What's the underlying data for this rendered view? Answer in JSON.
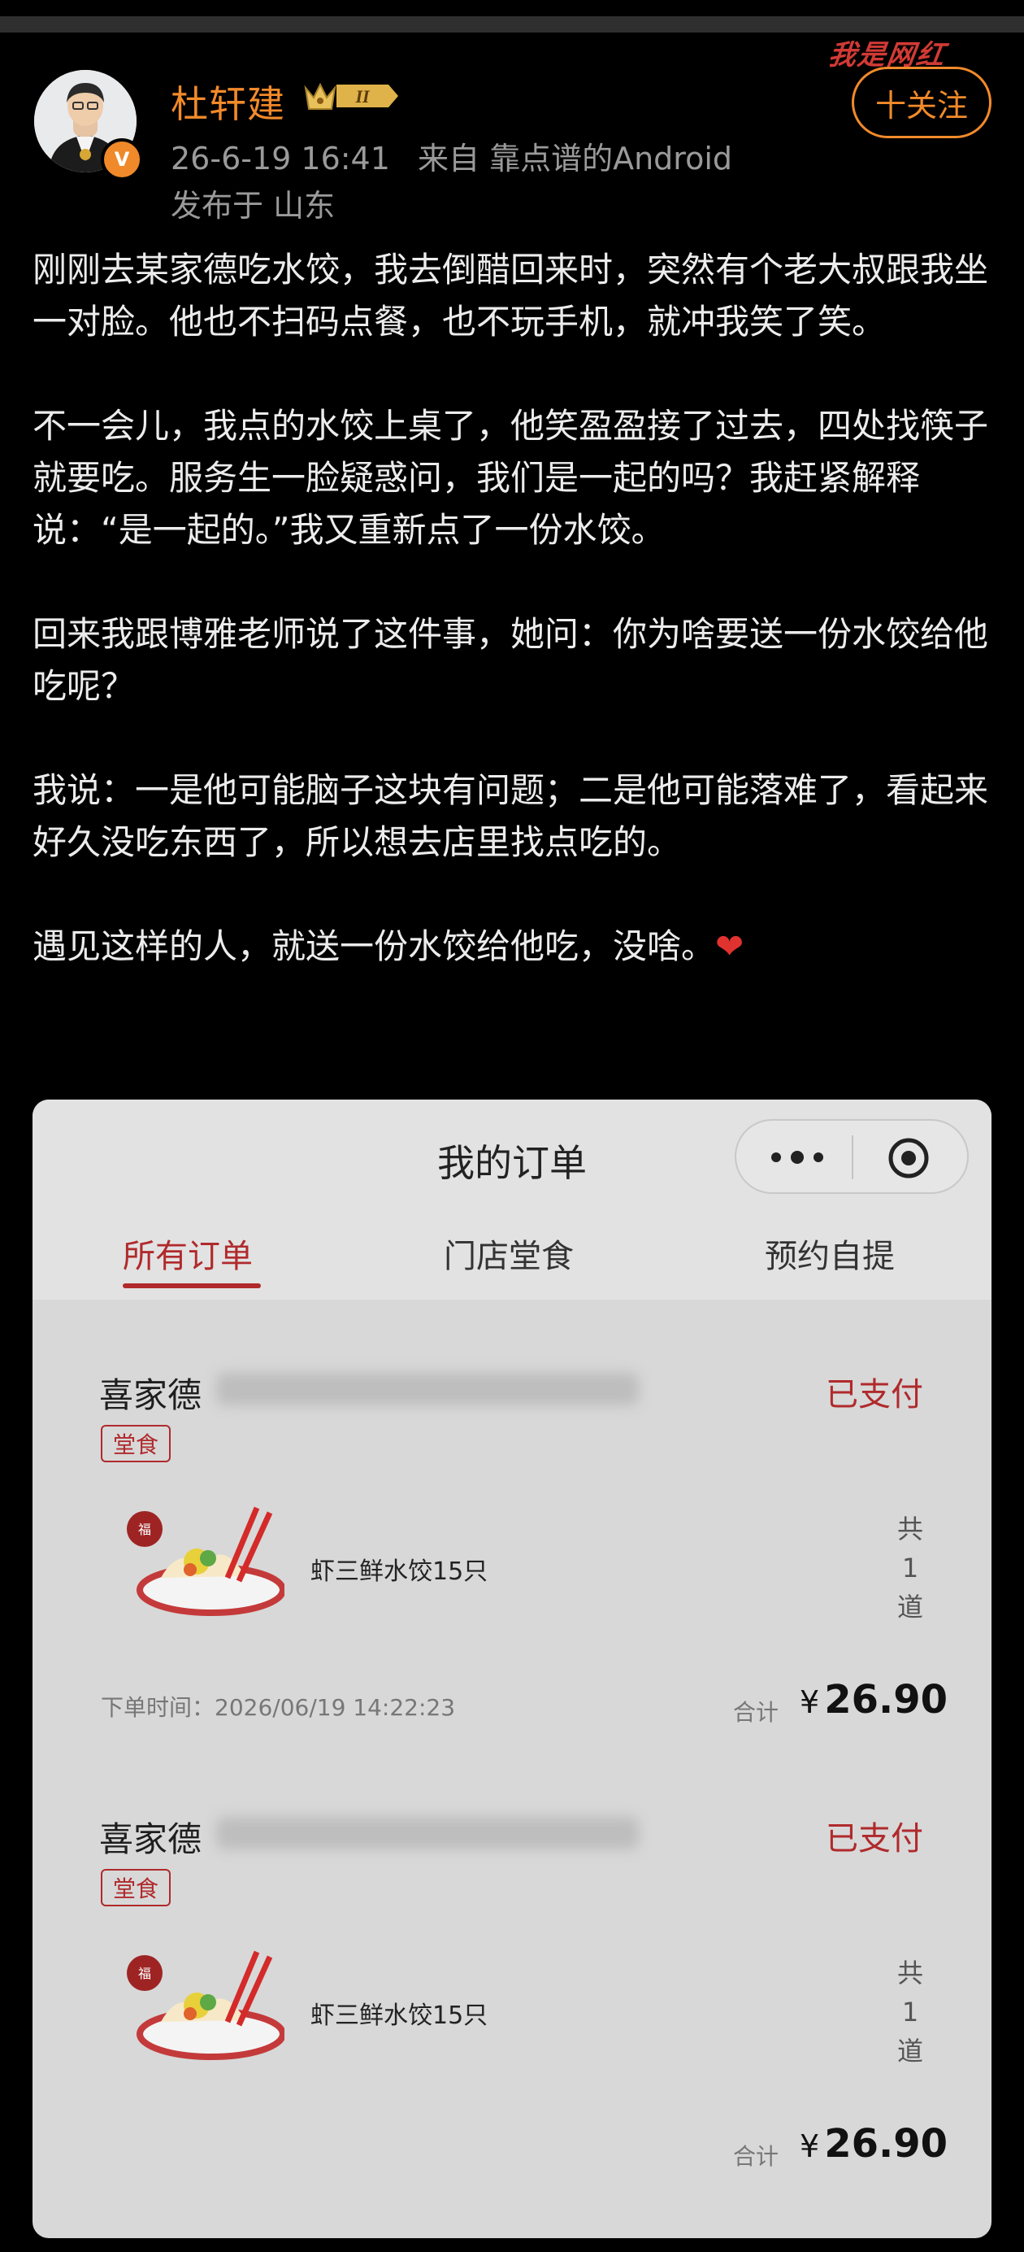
{
  "post": {
    "author": "杜轩建",
    "avatar_badge": "V",
    "level_badge": "II",
    "timestamp": "26-6-19 16:41",
    "source": "来自 靠点谱的Android",
    "location": "发布于 山东",
    "follow_label": "十关注",
    "watermark": "我是网红",
    "paragraphs": [
      "刚刚去某家德吃水饺，我去倒醋回来时，突然有个老大叔跟我坐一对脸。他也不扫码点餐，也不玩手机，就冲我笑了笑。",
      "不一会儿，我点的水饺上桌了，他笑盈盈接了过去，四处找筷子就要吃。服务生一脸疑惑问，我们是一起的吗？我赶紧解释说：“是一起的。”我又重新点了一份水饺。",
      "回来我跟博雅老师说了这件事，她问：你为啥要送一份水饺给他吃呢？",
      "我说：一是他可能脑子这块有问题；二是他可能落难了，看起来好久没吃东西了，所以想去店里找点吃的。",
      "遇见这样的人，就送一份水饺给他吃，没啥。"
    ],
    "heart": "❤"
  },
  "orders_page": {
    "title": "我的订单",
    "tabs": [
      "所有订单",
      "门店堂食",
      "预约自提"
    ],
    "active_tab": 0,
    "accent_color": "#b02a2c",
    "orders": [
      {
        "store": "喜家德",
        "status": "已支付",
        "tag": "堂食",
        "dish_name": "虾三鲜水饺15只",
        "count_prefix": "共",
        "count": "1",
        "count_unit": "道",
        "order_time": "下单时间：2026/06/19 14:22:23",
        "total_label": "合计",
        "currency": "¥",
        "total": "26.90"
      },
      {
        "store": "喜家德",
        "status": "已支付",
        "tag": "堂食",
        "dish_name": "虾三鲜水饺15只",
        "count_prefix": "共",
        "count": "1",
        "count_unit": "道",
        "total_label": "合计",
        "currency": "¥",
        "total": "26.90"
      }
    ]
  }
}
